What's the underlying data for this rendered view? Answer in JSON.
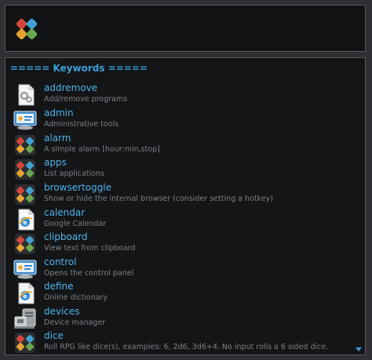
{
  "search": {
    "icon": "launcher-logo-icon"
  },
  "results": {
    "header": "===== Keywords =====",
    "items": [
      {
        "title": "addremove",
        "desc": "Add/remove programs",
        "icon": "gears-document-icon"
      },
      {
        "title": "admin",
        "desc": "Administrative tools",
        "icon": "control-panel-icon"
      },
      {
        "title": "alarm",
        "desc": "A simple alarm [hour:min,stop]",
        "icon": "launcher-logo-icon"
      },
      {
        "title": "apps",
        "desc": "List applications",
        "icon": "launcher-logo-icon"
      },
      {
        "title": "browsertoggle",
        "desc": "Show or hide the internal browser (consider setting a hotkey)",
        "icon": "launcher-logo-icon"
      },
      {
        "title": "calendar",
        "desc": "Google Calendar",
        "icon": "web-document-icon"
      },
      {
        "title": "clipboard",
        "desc": "View text from clipboard",
        "icon": "launcher-logo-icon"
      },
      {
        "title": "control",
        "desc": "Opens the control panel",
        "icon": "control-panel-icon"
      },
      {
        "title": "define",
        "desc": "Online dictionary",
        "icon": "web-document-icon"
      },
      {
        "title": "devices",
        "desc": "Device manager",
        "icon": "device-manager-icon"
      },
      {
        "title": "dice",
        "desc": "Roll RPG like dice(s), examples: 6, 2d6, 3d6+4. No input rolls a 6 sided dice.",
        "icon": "launcher-logo-icon"
      }
    ]
  },
  "colors": {
    "accent": "#3aa0d8",
    "title": "#4fb3ea",
    "description": "#7c8186",
    "panel": "#131517",
    "border": "#56585c"
  }
}
